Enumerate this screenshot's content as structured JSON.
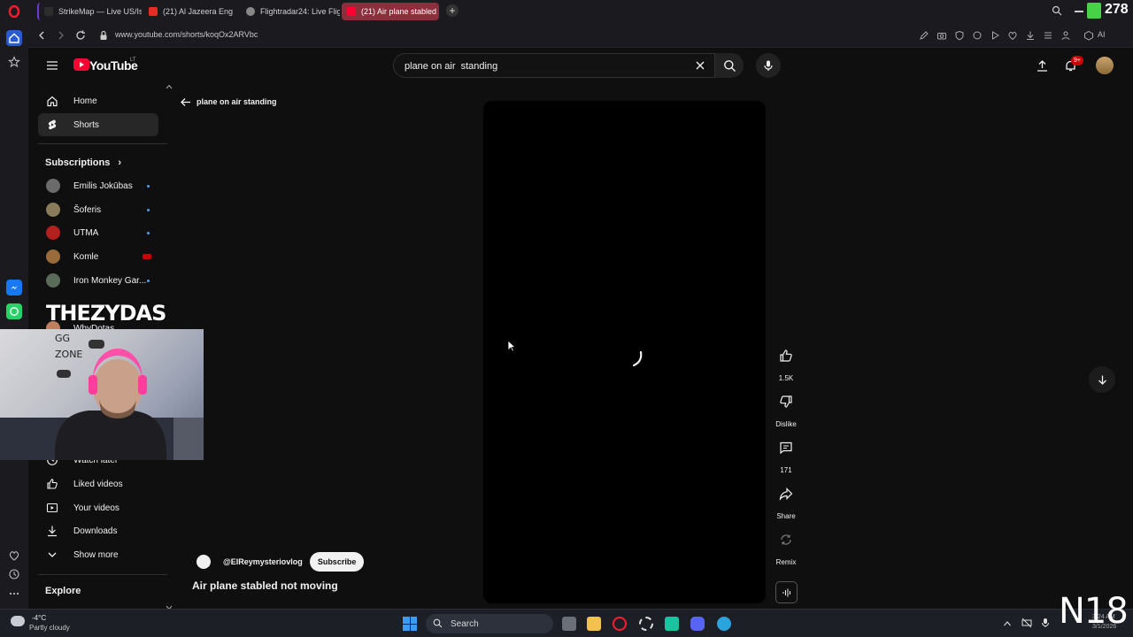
{
  "browser": {
    "tabs": [
      {
        "label": "StrikeMap — Live US/Isra",
        "favicon_color": "#2d2d2d"
      },
      {
        "label": "(21) Al Jazeera Eng",
        "favicon_color": "#e52d27"
      },
      {
        "label": "Flightradar24: Live Flight",
        "favicon_color": "#888888"
      },
      {
        "label": "(21) Air plane stabled not",
        "favicon_color": "#ff0033"
      }
    ],
    "url": "www.youtube.com/shorts/koqOx2ARVbc",
    "aria_label": "AI",
    "score_overlay": "278"
  },
  "header": {
    "logo": "YouTube",
    "region": "LT",
    "search_value": "plane on air  standing",
    "notification_badge": "9+"
  },
  "sidebar": {
    "nav": [
      {
        "label": "Home",
        "icon": "home-icon"
      },
      {
        "label": "Shorts",
        "icon": "shorts-icon"
      }
    ],
    "subscriptions_heading": "Subscriptions",
    "subscriptions": [
      {
        "label": "Emilis Jokūbas",
        "color": "#6b6b6b",
        "live": false
      },
      {
        "label": "Šoferis",
        "color": "#8a7b5a",
        "live": false
      },
      {
        "label": "UTMA",
        "color": "#b32020",
        "live": false
      },
      {
        "label": "Komle",
        "color": "#9a6b3a",
        "live": true
      },
      {
        "label": "Iron Monkey Gar...",
        "color": "#5a6b5a",
        "live": false
      },
      {
        "label": "WhyDotas",
        "color": "#c08060",
        "live": false
      }
    ],
    "you": [
      {
        "label": "Watch later",
        "icon": "clock-icon"
      },
      {
        "label": "Liked videos",
        "icon": "thumb-up-icon"
      },
      {
        "label": "Your videos",
        "icon": "video-icon"
      },
      {
        "label": "Downloads",
        "icon": "download-icon"
      },
      {
        "label": "Show more",
        "icon": "chevron-down-icon"
      }
    ],
    "explore_heading": "Explore"
  },
  "overlay": {
    "streamer_name": "THEZYDAS",
    "corner_text": "N18"
  },
  "shorts": {
    "back_label": "plane on air standing",
    "actions": [
      {
        "label": "1.5K",
        "icon": "thumb-up-icon"
      },
      {
        "label": "Dislike",
        "icon": "thumb-down-icon"
      },
      {
        "label": "171",
        "icon": "comment-icon"
      },
      {
        "label": "Share",
        "icon": "share-icon"
      },
      {
        "label": "Remix",
        "icon": "remix-icon"
      }
    ],
    "channel": "@ElReymysteriovlog",
    "subscribe_label": "Subscribe",
    "title": "Air plane stabled not moving"
  },
  "taskbar": {
    "weather_temp": "-4°C",
    "weather_desc": "Partly cloudy",
    "search_label": "Search",
    "time": "3:24 AM",
    "date": "3/1/2026"
  }
}
